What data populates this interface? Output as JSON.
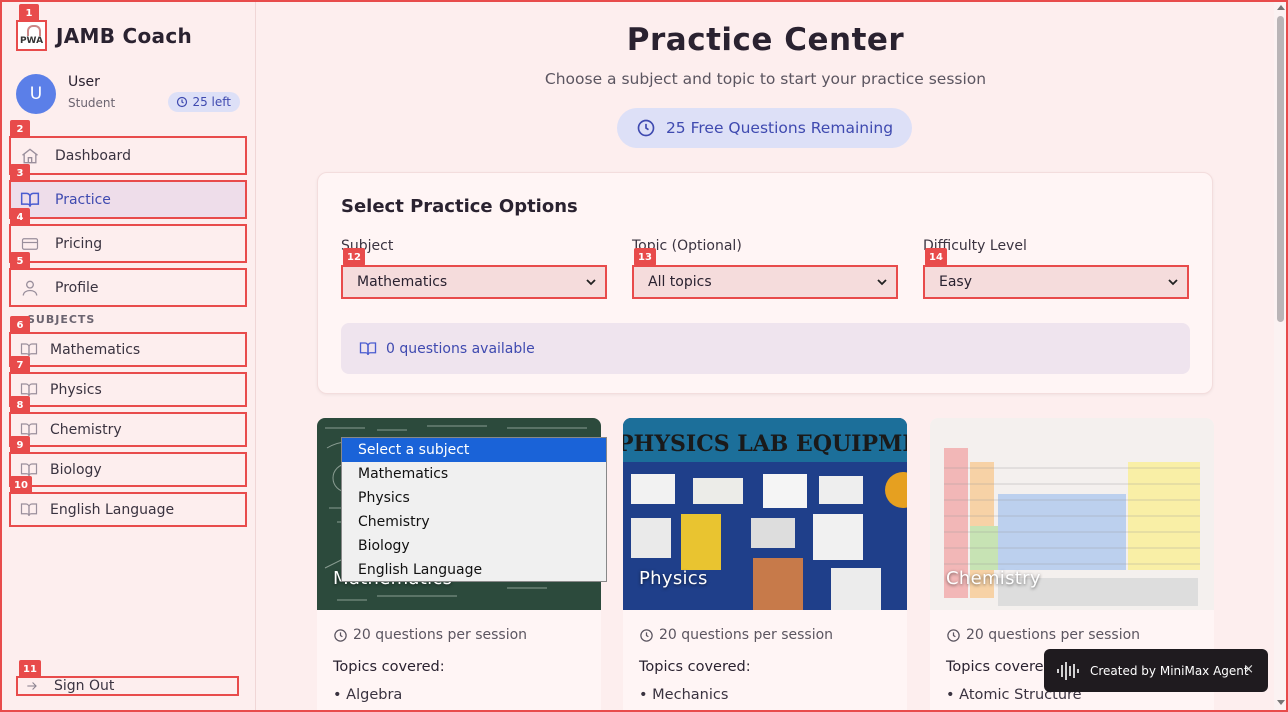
{
  "brand": {
    "logo_text": "PWA",
    "name": "JAMB Coach"
  },
  "user": {
    "initial": "U",
    "name": "User",
    "role": "Student",
    "badge": "25 left"
  },
  "nav": [
    {
      "label": "Dashboard",
      "icon": "home-icon"
    },
    {
      "label": "Practice",
      "icon": "book-open-icon",
      "active": true
    },
    {
      "label": "Pricing",
      "icon": "credit-card-icon"
    },
    {
      "label": "Profile",
      "icon": "user-icon"
    }
  ],
  "subjects_heading": "SUBJECTS",
  "subjects": [
    {
      "label": "Mathematics",
      "icon": "book-open-icon"
    },
    {
      "label": "Physics",
      "icon": "book-open-icon"
    },
    {
      "label": "Chemistry",
      "icon": "book-open-icon"
    },
    {
      "label": "Biology",
      "icon": "book-open-icon"
    },
    {
      "label": "English Language",
      "icon": "book-open-icon"
    }
  ],
  "signout_label": "Sign Out",
  "tags": [
    "1",
    "2",
    "3",
    "4",
    "5",
    "6",
    "7",
    "8",
    "9",
    "10",
    "11",
    "12",
    "13",
    "14"
  ],
  "page": {
    "title": "Practice Center",
    "subtitle": "Choose a subject and topic to start your practice session",
    "remaining": "25 Free Questions Remaining"
  },
  "options": {
    "title": "Select Practice Options",
    "subject_label": "Subject",
    "subject_value": "Mathematics",
    "topic_label": "Topic (Optional)",
    "topic_value": "All topics",
    "difficulty_label": "Difficulty Level",
    "difficulty_value": "Easy",
    "available": "0 questions available"
  },
  "subject_dropdown": [
    "Select a subject",
    "Mathematics",
    "Physics",
    "Chemistry",
    "Biology",
    "English Language"
  ],
  "cards": [
    {
      "title": "Mathematics",
      "meta": "20 questions per session",
      "topics_label": "Topics covered:",
      "topic1": "• Algebra"
    },
    {
      "title": "Physics",
      "banner": "PHYSICS LAB EQUIPMENT",
      "meta": "20 questions per session",
      "topics_label": "Topics covered:",
      "topic1": "• Mechanics"
    },
    {
      "title": "Chemistry",
      "meta": "20 questions per session",
      "topics_label": "Topics covered:",
      "topic1": "• Atomic Structure"
    }
  ],
  "toast": {
    "text": "Created by MiniMax Agent",
    "close": "×"
  },
  "colors": {
    "accent": "#3f4ab0",
    "highlight": "#e84b4b",
    "background": "#fdeeee",
    "selection": "#1a63d8"
  }
}
